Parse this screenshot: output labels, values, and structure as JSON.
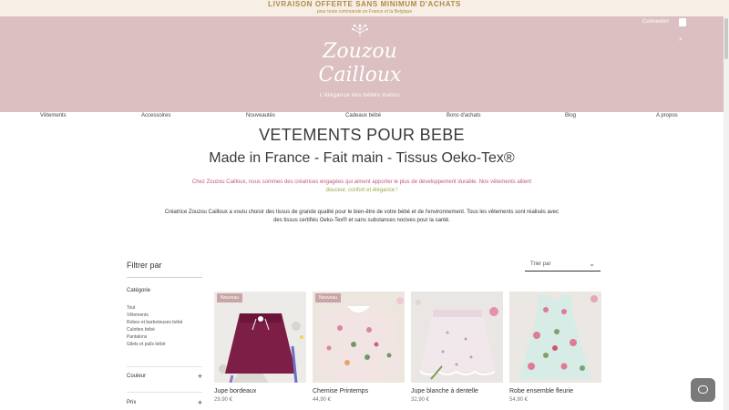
{
  "announcement": {
    "title": "LIVRAISON OFFERTE SANS MINIMUM D'ACHATS",
    "subtitle": "pour toute commande en France et la Belgique"
  },
  "brand": {
    "name": "Zouzou Cailloux",
    "tagline": "L'élégance des bébés malins"
  },
  "header": {
    "account_label": "Connexion"
  },
  "nav": [
    "Vêtements",
    "Accessoires",
    "Nouveautés",
    "Cadeaux bébé",
    "Bons d'achats",
    "Blog",
    "A propos"
  ],
  "page": {
    "title": "VETEMENTS POUR BEBE",
    "subtitle": "Made in France - Fait main - Tissus Oeko-Tex®",
    "intro_1": "Chez Zouzou Cailloux, nous sommes des créatrices engagées qui aiment apporter le plus de développement durable. Nos vêtements allient",
    "intro_1_end": "douceur, confort et élégance !",
    "intro_2": "Créatrice Zouzou Cailloux a voulu choisir des tissus de grande qualité pour le bien-être de votre bébé et de l'environnement. Tous les vêtements sont réalisés avec des tissus certifiés Oeko-Tex® et sans substances nocives pour la santé."
  },
  "filters": {
    "title": "Filtrer par",
    "category_title": "Catégorie",
    "categories": [
      "Tout",
      "Vêtements",
      "Robes et barboteuses bébé",
      "Culottes bébé",
      "Pantalons",
      "Gilets et pulls bébé"
    ],
    "facets": [
      {
        "label": "Couleur",
        "toggle": "+"
      },
      {
        "label": "Prix",
        "toggle": "+"
      }
    ]
  },
  "sort": {
    "value": "Trier par",
    "chevron": "⌄"
  },
  "products": [
    {
      "name": "Jupe bordeaux",
      "price": "29,90 €",
      "badge": "Nouveau",
      "art": "skirt"
    },
    {
      "name": "Chemise Printemps",
      "price": "44,90 €",
      "badge": "Nouveau",
      "art": "blouse"
    },
    {
      "name": "Jupe blanche à dentelle",
      "price": "32,90 €",
      "badge": "",
      "art": "lace"
    },
    {
      "name": "Robe ensemble fleurie",
      "price": "54,90 €",
      "badge": "",
      "art": "dress"
    }
  ],
  "colors": {
    "hero_pink": "#dbbfc1",
    "announcement_bg": "#f7efe5",
    "accent_gold": "#b08a4a",
    "intro_pink": "#c0587a",
    "badge_pink": "#c9a5a6"
  },
  "icons": {
    "cart": "shopping-bag-icon",
    "search": "search-icon",
    "chat": "chat-icon",
    "sprig": "sprig-icon"
  }
}
